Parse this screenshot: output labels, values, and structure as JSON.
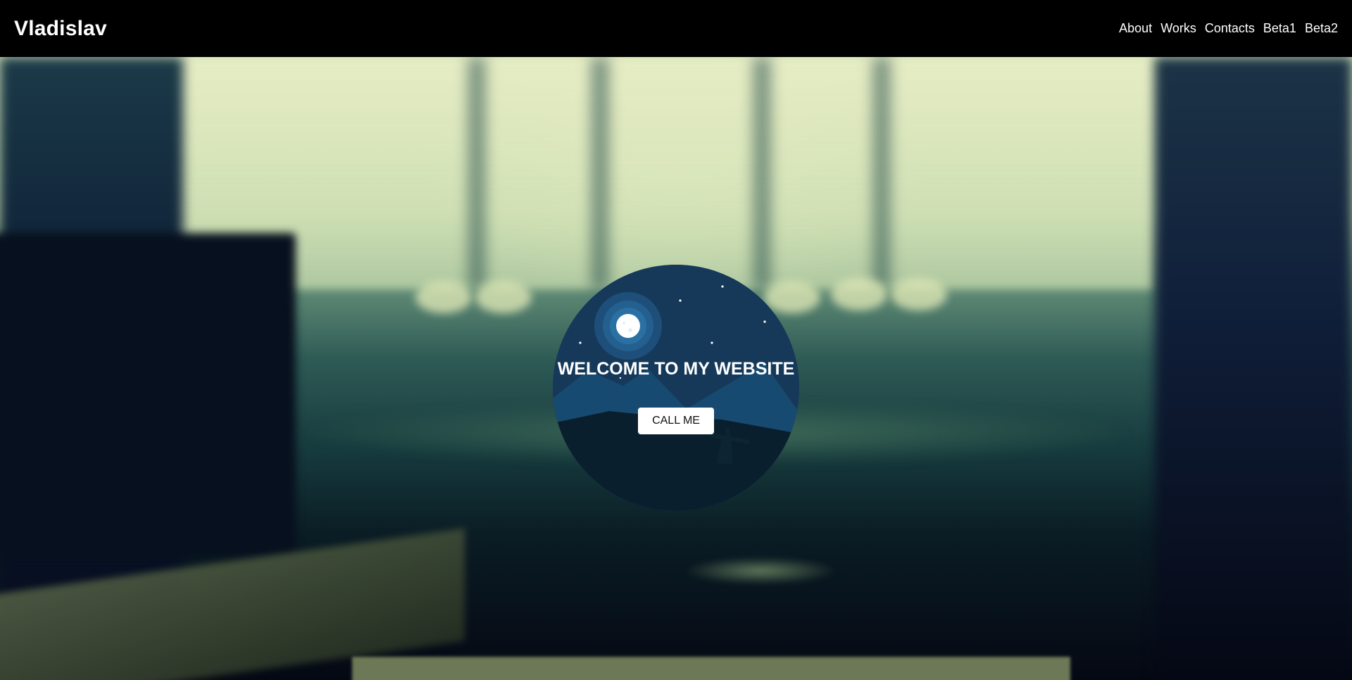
{
  "header": {
    "brand": "Vladislav",
    "nav": [
      {
        "label": "About"
      },
      {
        "label": "Works"
      },
      {
        "label": "Contacts"
      },
      {
        "label": "Beta1"
      },
      {
        "label": "Beta2"
      }
    ]
  },
  "hero": {
    "title": "WELCOME TO MY WEBSITE",
    "button_label": "CALL ME"
  },
  "colors": {
    "navbar_bg": "#000000",
    "circle_sky": "#16395a",
    "mountain": "#174a70",
    "ground": "#0a1f2e",
    "moon": "#ffffff"
  },
  "icons": [
    "moon-icon",
    "windmill-icon",
    "stars-icon"
  ]
}
